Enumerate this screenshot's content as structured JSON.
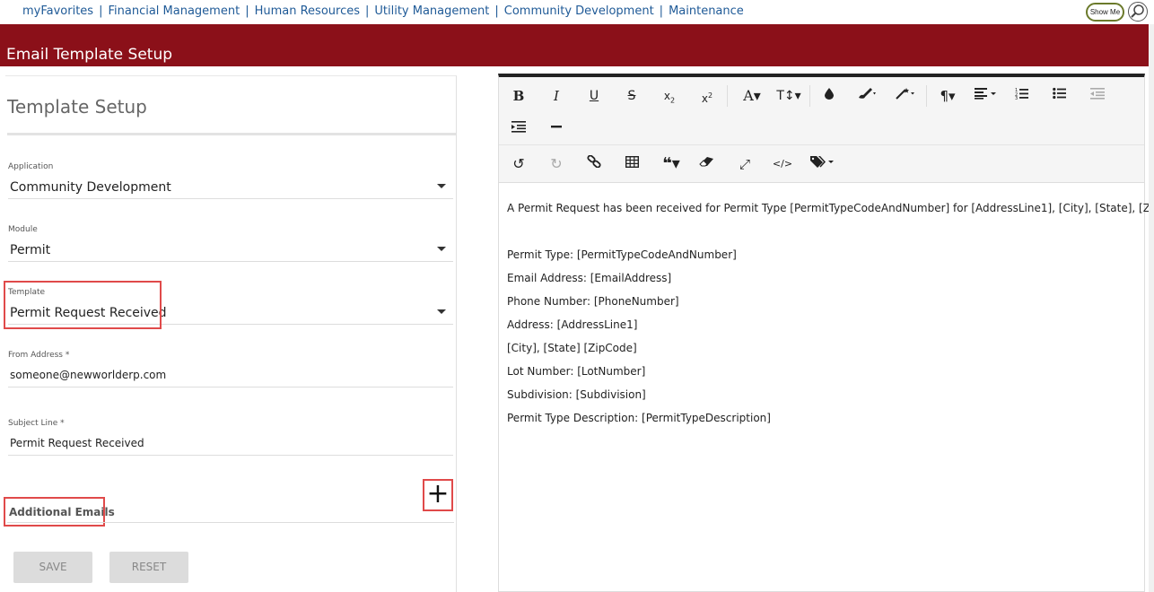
{
  "topnav": {
    "links": [
      "myFavorites",
      "Financial Management",
      "Human Resources",
      "Utility Management",
      "Community Development",
      "Maintenance"
    ],
    "show_me": "Show Me"
  },
  "page": {
    "title": "Email Template Setup"
  },
  "template_setup": {
    "title": "Template Setup",
    "application": {
      "label": "Application",
      "value": "Community Development"
    },
    "module": {
      "label": "Module",
      "value": "Permit"
    },
    "template": {
      "label": "Template",
      "value": "Permit Request Received"
    },
    "from_address": {
      "label": "From Address *",
      "value": "someone@newworlderp.com"
    },
    "subject_line": {
      "label": "Subject Line *",
      "value": "Permit Request Received"
    },
    "additional_emails": {
      "label": "Additional Emails",
      "add_symbol": "+"
    },
    "save_label": "SAVE",
    "reset_label": "RESET"
  },
  "editor": {
    "toolbar_row1": [
      "bold-icon",
      "italic-icon",
      "underline-icon",
      "strikethrough-icon",
      "subscript-icon",
      "superscript-icon",
      "font-icon",
      "font-size-icon",
      "color-icon",
      "brush-icon",
      "magic-icon",
      "paragraph-icon",
      "align-icon",
      "ordered-list-icon",
      "unordered-list-icon",
      "outdent-icon"
    ],
    "toolbar_row2": [
      "indent-icon",
      "horizontal-rule-icon"
    ],
    "toolbar_row3": [
      "undo-icon",
      "redo-icon",
      "link-icon",
      "table-icon",
      "quote-icon",
      "eraser-icon",
      "fullscreen-icon",
      "code-icon",
      "tags-icon"
    ],
    "lines": [
      "A Permit Request has been received for Permit Type [PermitTypeCodeAndNumber] for [AddressLine1], [City], [State], [ZipCode].",
      "Permit Type: [PermitTypeCodeAndNumber]",
      "Email Address: [EmailAddress]",
      "Phone Number: [PhoneNumber]",
      "Address: [AddressLine1]",
      "[City], [State]  [ZipCode]",
      "Lot Number: [LotNumber]",
      "Subdivision: [Subdivision]",
      "Permit Type Description: [PermitTypeDescription]"
    ]
  }
}
